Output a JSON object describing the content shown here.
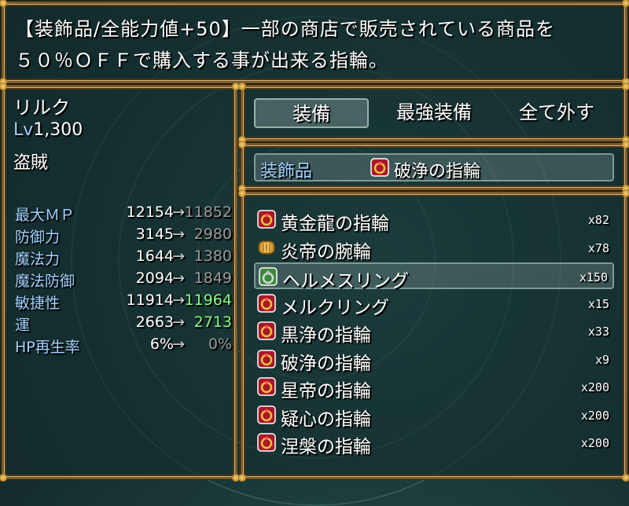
{
  "help": {
    "line1": "【装飾品/全能力値+50】一部の商店で販売されている商品を",
    "line2": "５０％ＯＦＦで購入する事が出来る指輪。"
  },
  "actor": {
    "name": "リルク",
    "level_label": "Lv",
    "level_value": "1,300",
    "class": "盗賊"
  },
  "params": [
    {
      "label": "最大ＭＰ",
      "current": "12154",
      "arrow": "→",
      "next": "11852",
      "trend": "down"
    },
    {
      "label": "防御力",
      "current": "3145",
      "arrow": "→",
      "next": "2980",
      "trend": "down"
    },
    {
      "label": "魔法力",
      "current": "1644",
      "arrow": "→",
      "next": "1380",
      "trend": "down"
    },
    {
      "label": "魔法防御",
      "current": "2094",
      "arrow": "→",
      "next": "1849",
      "trend": "down"
    },
    {
      "label": "敏捷性",
      "current": "11914",
      "arrow": "→",
      "next": "11964",
      "trend": "up"
    },
    {
      "label": "運",
      "current": "2663",
      "arrow": "→",
      "next": "2713",
      "trend": "up"
    },
    {
      "label": "HP再生率",
      "current": "6%",
      "arrow": "→",
      "next": "0%",
      "trend": "down"
    }
  ],
  "commands": [
    {
      "label": "装備",
      "selected": true
    },
    {
      "label": "最強装備",
      "selected": false
    },
    {
      "label": "全て外す",
      "selected": false
    }
  ],
  "slot": {
    "type": "装飾品",
    "icon": "red-ring-icon",
    "item": "破浄の指輪"
  },
  "items": [
    {
      "name": "黄金龍の指輪",
      "qty": "x82",
      "icon": "red-ring-icon",
      "selected": false
    },
    {
      "name": "炎帝の腕輪",
      "qty": "x78",
      "icon": "gold-bracelet-icon",
      "selected": false
    },
    {
      "name": "ヘルメスリング",
      "qty": "x150",
      "icon": "green-ring-icon",
      "selected": true
    },
    {
      "name": "メルクリング",
      "qty": "x15",
      "icon": "red-ring-icon",
      "selected": false
    },
    {
      "name": "黒浄の指輪",
      "qty": "x33",
      "icon": "red-ring-icon",
      "selected": false
    },
    {
      "name": "破浄の指輪",
      "qty": "x9",
      "icon": "red-ring-icon",
      "selected": false
    },
    {
      "name": "星帝の指輪",
      "qty": "x200",
      "icon": "red-ring-icon",
      "selected": false
    },
    {
      "name": "疑心の指輪",
      "qty": "x200",
      "icon": "red-ring-icon",
      "selected": false
    },
    {
      "name": "涅槃の指輪",
      "qty": "x200",
      "icon": "red-ring-icon",
      "selected": false
    }
  ],
  "colors": {
    "system_blue": "#9fd0ff",
    "stat_down": "#9a9a9a",
    "stat_up": "#80ff80",
    "frame_gold": "#c9962e"
  }
}
